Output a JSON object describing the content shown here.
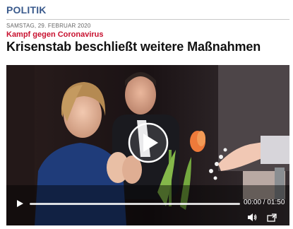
{
  "section": {
    "label": "POLITIK"
  },
  "article": {
    "date": "SAMSTAG, 29. FEBRUAR 2020",
    "kicker": "Kampf gegen Coronavirus",
    "headline": "Krisenstab beschließt weitere Maßnahmen"
  },
  "video": {
    "current_time": "00:00",
    "separator": " / ",
    "duration": "01:50",
    "progress_fraction": 0.0,
    "icons": {
      "big_play": "play-circle-icon",
      "play": "play-icon",
      "volume": "volume-icon",
      "fullscreen": "fullscreen-icon"
    }
  },
  "colors": {
    "section": "#3a5a8c",
    "kicker": "#c8102e",
    "headline": "#111111",
    "player_bg": "#120d0e"
  }
}
